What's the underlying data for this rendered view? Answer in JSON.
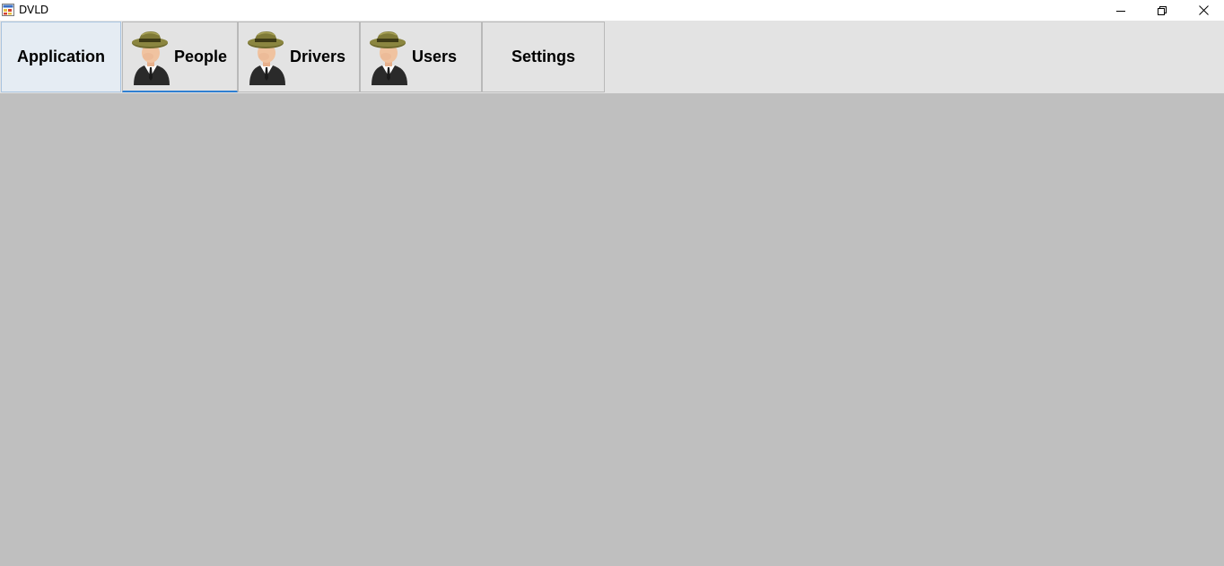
{
  "window": {
    "title": "DVLD",
    "icon": "app-window-icon",
    "controls": {
      "minimize_icon": "minimize-icon",
      "maximize_icon": "restore-icon",
      "close_icon": "close-icon"
    }
  },
  "menu": {
    "items": [
      {
        "label": "Application",
        "icon": null,
        "state": "selected"
      },
      {
        "label": "People",
        "icon": "person-hat-icon",
        "state": "active"
      },
      {
        "label": "Drivers",
        "icon": "person-hat-icon",
        "state": "normal"
      },
      {
        "label": "Users",
        "icon": "person-hat-icon",
        "state": "normal"
      },
      {
        "label": "Settings",
        "icon": null,
        "state": "normal"
      }
    ]
  },
  "colors": {
    "menu_background": "#e3e3e3",
    "client_background": "#bfbfbf",
    "accent": "#2f7fd1"
  }
}
